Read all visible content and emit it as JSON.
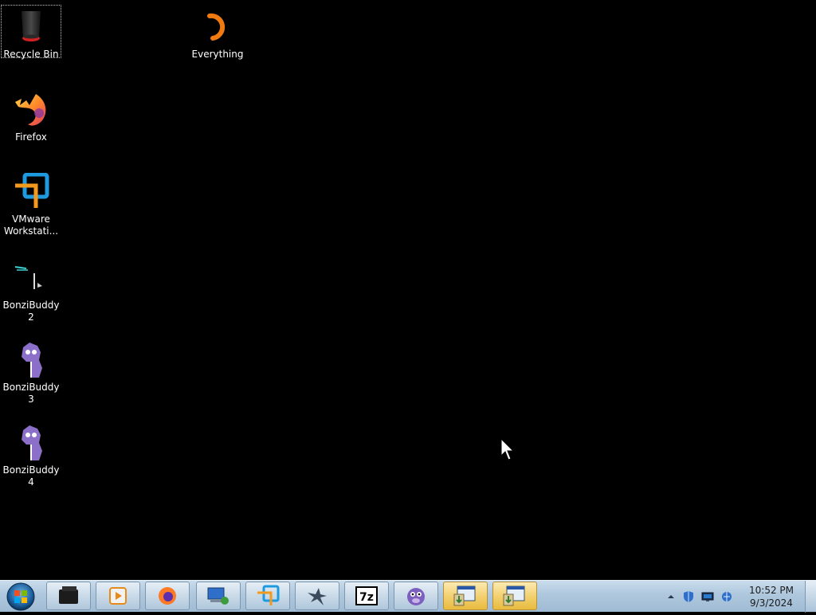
{
  "desktop": {
    "icons": [
      {
        "label": "Recycle Bin",
        "icon": "recycle-bin-icon"
      },
      {
        "label": "Everything",
        "icon": "everything-search-icon"
      },
      {
        "label": "Firefox",
        "icon": "firefox-icon"
      },
      {
        "label": "VMware Workstati...",
        "icon": "vmware-workstation-icon"
      },
      {
        "label": "BonziBuddy2",
        "icon": "bonzibuddy-shortcut-icon"
      },
      {
        "label": "BonziBuddy3",
        "icon": "bonzi-gorilla-icon"
      },
      {
        "label": "BonziBuddy4",
        "icon": "bonzi-gorilla-icon"
      }
    ]
  },
  "taskbar": {
    "start_icon": "windows-orb-icon",
    "pinned": [
      {
        "icon": "terminal-icon"
      },
      {
        "icon": "media-player-icon"
      },
      {
        "icon": "firefox-icon"
      },
      {
        "icon": "network-computer-icon"
      },
      {
        "icon": "vmware-workstation-icon"
      },
      {
        "icon": "eagle-icon"
      },
      {
        "icon": "7zip-icon"
      },
      {
        "icon": "bonzi-gorilla-icon"
      },
      {
        "icon": "installer-window-icon"
      },
      {
        "icon": "installer-window-icon"
      }
    ],
    "tray": {
      "icons": [
        "show-hidden-icons-arrow",
        "security-shield-icon",
        "display-monitor-icon",
        "network-icon"
      ],
      "time": "10:52 PM",
      "date": "9/3/2024"
    }
  },
  "colors": {
    "desktop_background": "#000000",
    "taskbar_top": "#c9dcec",
    "taskbar_bottom": "#9fbbd4",
    "active_button": "#f2cf6b"
  }
}
